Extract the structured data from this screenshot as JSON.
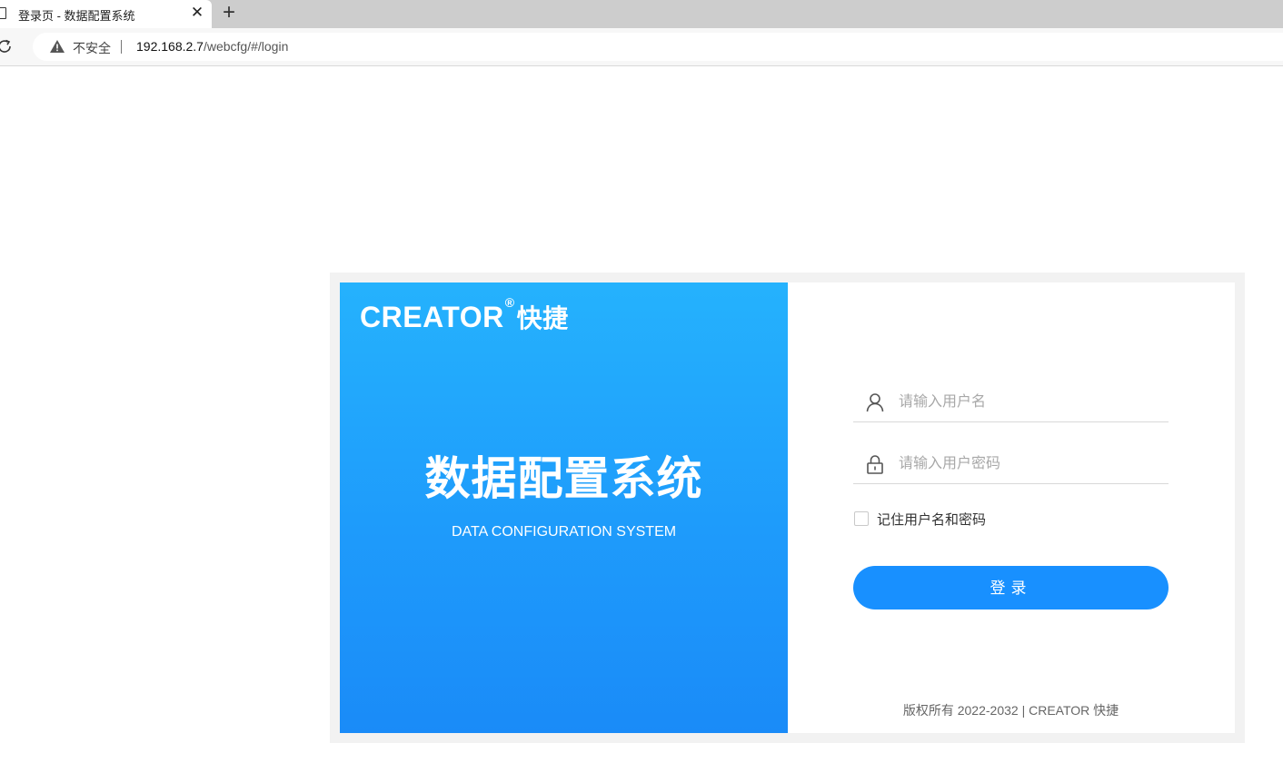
{
  "browser": {
    "tab": {
      "title": "登录页 - 数据配置系统",
      "close_glyph": "✕",
      "icon": "page-icon"
    },
    "new_tab_glyph": "+",
    "address_bar": {
      "security_label": "不安全",
      "url_host": "192.168.2.7",
      "url_path": "/webcfg/#/login"
    }
  },
  "hero": {
    "logo_text": "CREATOR",
    "logo_mark": "®",
    "logo_cn": "快捷",
    "title": "数据配置系统",
    "subtitle": "DATA CONFIGURATION SYSTEM"
  },
  "form": {
    "username_placeholder": "请输入用户名",
    "password_placeholder": "请输入用户密码",
    "remember_label": "记住用户名和密码",
    "remember_checked": false,
    "login_label": "登录",
    "copyright": "版权所有 2022-2032 | CREATOR 快捷"
  },
  "colors": {
    "hero_gradient_top": "#25b2fd",
    "hero_gradient_bottom": "#1a8bf8",
    "button": "#1890ff"
  }
}
